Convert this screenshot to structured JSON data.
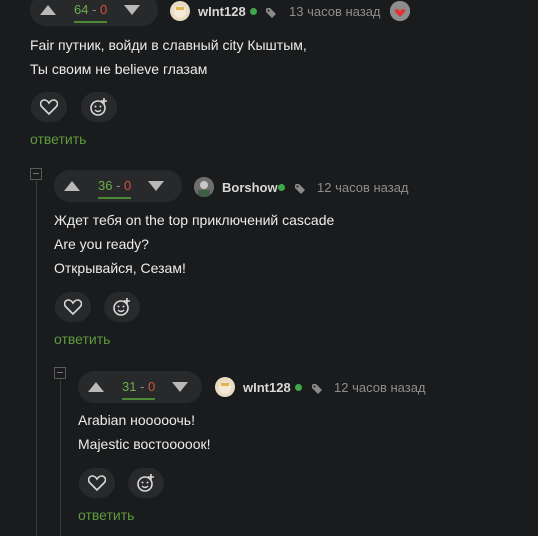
{
  "comments": [
    {
      "score_pos": "64",
      "score_sep": " - ",
      "score_neg": "0",
      "username": "wInt128",
      "time": "13 часов назад",
      "lines": [
        "Fair путник, войди в славный city Кыштым,",
        "Ты своим не believe глазам"
      ],
      "reply": "ответить"
    },
    {
      "score_pos": "36",
      "score_sep": " - ",
      "score_neg": "0",
      "username": "Borshow",
      "time": "12 часов назад",
      "lines": [
        "Ждет тебя on the top приключений cascade",
        "Are you ready?",
        "Открывайся, Сезам!"
      ],
      "reply": "ответить"
    },
    {
      "score_pos": "31",
      "score_sep": " - ",
      "score_neg": "0",
      "username": "wInt128",
      "time": "12 часов назад",
      "lines": [
        "Arabian нооооочь!",
        "Majestic востооооок!"
      ],
      "reply": "ответить"
    }
  ],
  "colors": {
    "background": "#1a1b1c",
    "panel": "#27292b",
    "positive": "#6cae4a",
    "negative": "#d4543f",
    "link": "#5d9c3f",
    "online": "#3fa84a"
  },
  "icons": [
    "upvote-icon",
    "downvote-icon",
    "tag-icon",
    "heart-icon",
    "emoji-add-icon",
    "collapse-icon"
  ]
}
